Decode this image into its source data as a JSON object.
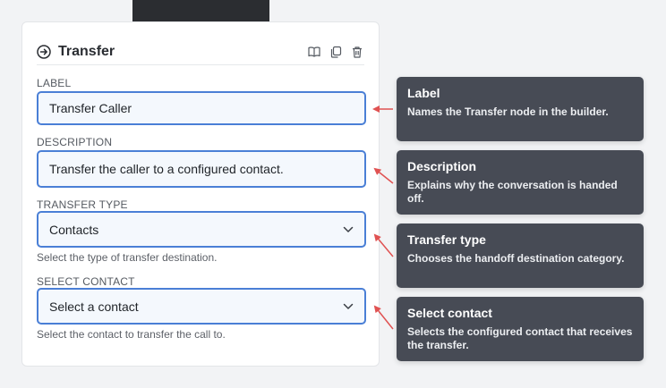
{
  "panel": {
    "title": "Transfer",
    "actions": [
      "book-icon",
      "copy-icon",
      "trash-icon"
    ]
  },
  "fields": {
    "label": {
      "label": "LABEL",
      "value": "Transfer Caller"
    },
    "description": {
      "label": "DESCRIPTION",
      "value": "Transfer the caller to a configured contact."
    },
    "transfer_type": {
      "label": "TRANSFER TYPE",
      "value": "Contacts",
      "help": "Select the type of transfer destination."
    },
    "select_contact": {
      "label": "SELECT CONTACT",
      "value": "Select a contact",
      "help": "Select the contact to transfer the call to."
    }
  },
  "tooltips": [
    {
      "title": "Label",
      "desc": "Names the Transfer node in the builder."
    },
    {
      "title": "Description",
      "desc": "Explains why the conversation is handed off."
    },
    {
      "title": "Transfer type",
      "desc": "Chooses the handoff destination category."
    },
    {
      "title": "Select contact",
      "desc": "Selects the configured contact that receives the transfer."
    }
  ],
  "colors": {
    "accent": "#4a7fd6",
    "tooltip_bg": "#474b55",
    "arrow": "#e05252"
  }
}
